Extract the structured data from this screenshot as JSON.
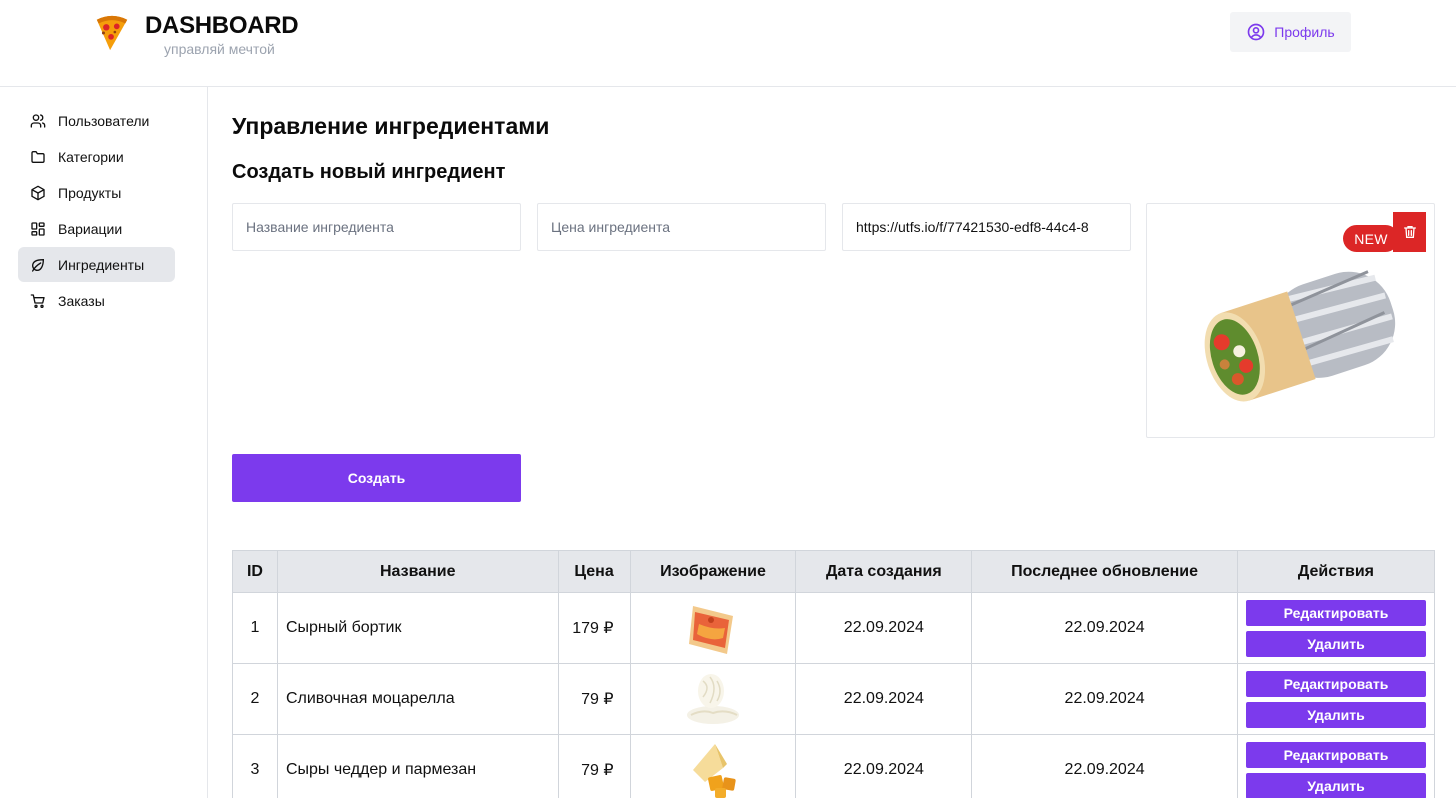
{
  "brand": {
    "title": "DASHBOARD",
    "subtitle": "управляй мечтой"
  },
  "header": {
    "profile_label": "Профиль"
  },
  "sidebar": {
    "items": [
      {
        "label": "Пользователи",
        "icon": "users-icon"
      },
      {
        "label": "Категории",
        "icon": "folder-icon"
      },
      {
        "label": "Продукты",
        "icon": "box-icon"
      },
      {
        "label": "Вариации",
        "icon": "grid-icon"
      },
      {
        "label": "Ингредиенты",
        "icon": "leaf-icon",
        "active": true
      },
      {
        "label": "Заказы",
        "icon": "cart-icon"
      }
    ]
  },
  "main": {
    "title": "Управление ингредиентами",
    "form": {
      "title": "Создать новый ингредиент",
      "name_placeholder": "Название ингредиента",
      "price_placeholder": "Цена ингредиента",
      "image_url_value": "https://utfs.io/f/77421530-edf8-44c4-8",
      "badge": "NEW",
      "submit_label": "Создать"
    },
    "table": {
      "headers": [
        "ID",
        "Название",
        "Цена",
        "Изображение",
        "Дата создания",
        "Последнее обновление",
        "Действия"
      ],
      "rows": [
        {
          "id": "1",
          "name": "Сырный бортик",
          "price": "179 ₽",
          "created": "22.09.2024",
          "updated": "22.09.2024",
          "edit": "Редактировать",
          "delete": "Удалить"
        },
        {
          "id": "2",
          "name": "Сливочная моцарелла",
          "price": "79 ₽",
          "created": "22.09.2024",
          "updated": "22.09.2024",
          "edit": "Редактировать",
          "delete": "Удалить"
        },
        {
          "id": "3",
          "name": "Сыры чеддер и пармезан",
          "price": "79 ₽",
          "created": "22.09.2024",
          "updated": "22.09.2024",
          "edit": "Редактировать",
          "delete": "Удалить"
        }
      ]
    }
  },
  "colors": {
    "accent": "#7c3aed",
    "danger": "#dc2626",
    "border": "#e5e7eb"
  }
}
